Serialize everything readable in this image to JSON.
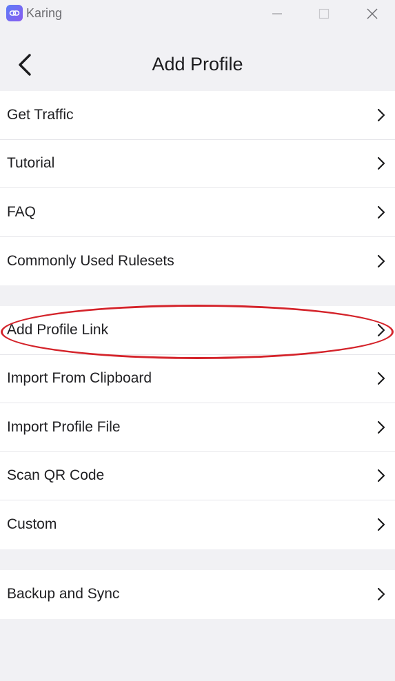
{
  "app": {
    "title": "Karing",
    "icon": "karing-link-icon"
  },
  "window_controls": [
    "minimize-icon",
    "maximize-icon",
    "close-icon"
  ],
  "header": {
    "title": "Add Profile",
    "back_icon": "chevron-left-icon"
  },
  "groups": [
    {
      "items": [
        {
          "label": "Get Traffic"
        },
        {
          "label": "Tutorial"
        },
        {
          "label": "FAQ"
        },
        {
          "label": "Commonly Used Rulesets"
        }
      ]
    },
    {
      "items": [
        {
          "label": "Add Profile Link"
        },
        {
          "label": "Import From Clipboard"
        },
        {
          "label": "Import Profile File"
        },
        {
          "label": "Scan QR Code"
        },
        {
          "label": "Custom"
        }
      ]
    },
    {
      "items": [
        {
          "label": "Backup and Sync"
        }
      ]
    }
  ],
  "annotation": {
    "color": "#d4232a"
  }
}
